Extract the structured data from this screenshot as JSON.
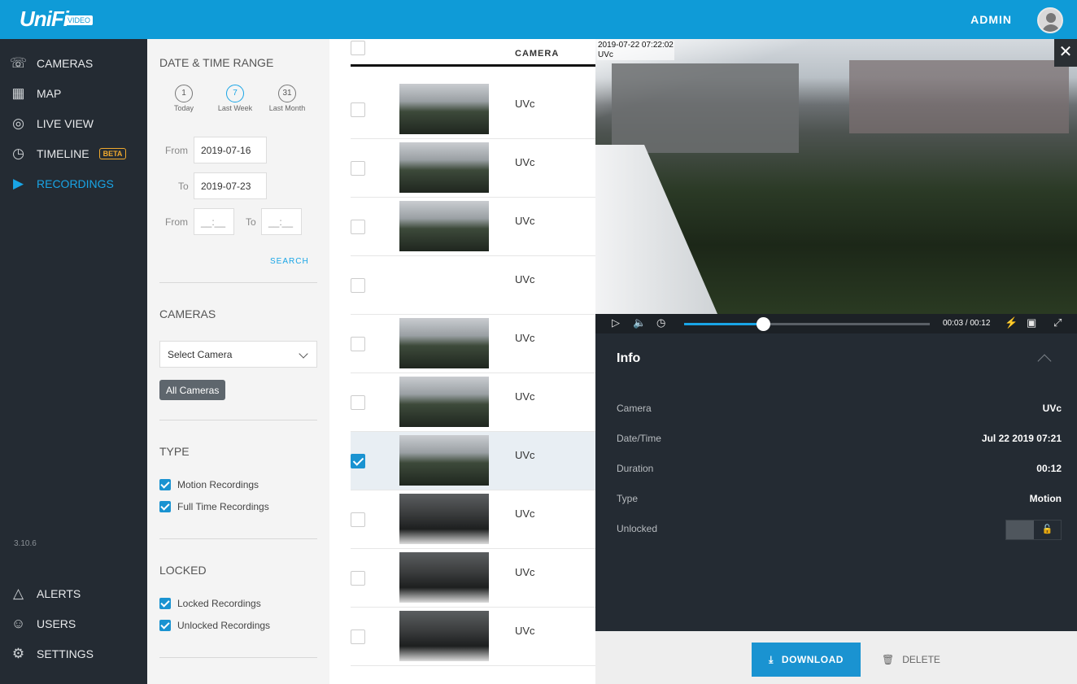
{
  "topbar": {
    "logo": "UniFi",
    "logo_badge": "VIDEO",
    "user": "ADMIN"
  },
  "sidebar": {
    "items": [
      {
        "label": "CAMERAS",
        "icon": "camera-icon"
      },
      {
        "label": "MAP",
        "icon": "map-icon"
      },
      {
        "label": "LIVE VIEW",
        "icon": "live-view-icon"
      },
      {
        "label": "TIMELINE",
        "icon": "clock-icon",
        "badge": "BETA"
      },
      {
        "label": "RECORDINGS",
        "icon": "play-square-icon",
        "active": true
      }
    ],
    "bottom_items": [
      {
        "label": "ALERTS",
        "icon": "bell-icon"
      },
      {
        "label": "USERS",
        "icon": "users-icon"
      },
      {
        "label": "SETTINGS",
        "icon": "gear-icon"
      }
    ],
    "version": "3.10.6"
  },
  "filters": {
    "date_title": "DATE & TIME RANGE",
    "quick": [
      {
        "num": "1",
        "label": "Today"
      },
      {
        "num": "7",
        "label": "Last Week",
        "selected": true
      },
      {
        "num": "31",
        "label": "Last Month"
      }
    ],
    "from_label": "From",
    "to_label": "To",
    "from_date": "2019-07-16",
    "to_date": "2019-07-23",
    "from_time": "__:__",
    "to_time": "__:__",
    "search": "SEARCH",
    "cameras_title": "CAMERAS",
    "select_camera": "Select Camera",
    "all_cameras": "All Cameras",
    "type_title": "TYPE",
    "motion": "Motion Recordings",
    "full_time": "Full Time Recordings",
    "locked_title": "LOCKED",
    "locked": "Locked Recordings",
    "unlocked": "Unlocked Recordings"
  },
  "list": {
    "header": "CAMERA",
    "rows": [
      {
        "camera": "UVc",
        "thumb": "day"
      },
      {
        "camera": "UVc",
        "thumb": "day"
      },
      {
        "camera": "UVc",
        "thumb": "day"
      },
      {
        "camera": "UVc",
        "thumb": "blank"
      },
      {
        "camera": "UVc",
        "thumb": "day"
      },
      {
        "camera": "UVc",
        "thumb": "day"
      },
      {
        "camera": "UVc",
        "thumb": "day",
        "selected": true
      },
      {
        "camera": "UVc",
        "thumb": "dark"
      },
      {
        "camera": "UVc",
        "thumb": "dark"
      },
      {
        "camera": "UVc",
        "thumb": "dark"
      }
    ]
  },
  "viewer": {
    "osd_time": "2019-07-22 07:22:02",
    "osd_cam": "UVc",
    "time": "00:03 / 00:12",
    "progress": 0.32,
    "info_title": "Info",
    "info": [
      {
        "label": "Camera",
        "value": "UVc"
      },
      {
        "label": "Date/Time",
        "value": "Jul 22 2019 07:21"
      },
      {
        "label": "Duration",
        "value": "00:12"
      },
      {
        "label": "Type",
        "value": "Motion"
      },
      {
        "label": "Unlocked",
        "value": ""
      }
    ],
    "download": "DOWNLOAD",
    "delete": "DELETE"
  }
}
